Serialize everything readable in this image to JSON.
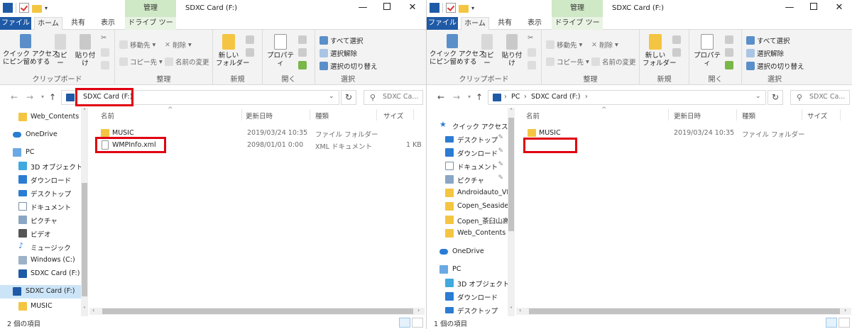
{
  "left": {
    "title": "SDXC Card (F:)",
    "manage_tab": "管理",
    "tabs": [
      "ファイル",
      "ホーム",
      "共有",
      "表示",
      "ドライブ ツール"
    ],
    "ribbon": {
      "pin_label": "クイック アクセス\nにピン留めする",
      "copy": "コピー",
      "paste": "貼り付け",
      "clipboard_group": "クリップボード",
      "move_to": "移動先",
      "delete": "削除",
      "copy_to": "コピー先",
      "rename": "名前の変更",
      "organize_group": "整理",
      "new_folder": "新しい\nフォルダー",
      "new_group": "新規",
      "properties": "プロパティ",
      "open_group": "開く",
      "select_all": "すべて選択",
      "select_none": "選択解除",
      "invert_selection": "選択の切り替え",
      "select_group": "選択"
    },
    "address": {
      "path": "SDXC Card (F:)",
      "search_placeholder": "SDXC Ca..."
    },
    "nav_items": [
      "Web_Contents",
      "OneDrive",
      "PC",
      "3D オブジェクト",
      "ダウンロード",
      "デスクトップ",
      "ドキュメント",
      "ピクチャ",
      "ビデオ",
      "ミュージック",
      "Windows (C:)",
      "SDXC Card (F:)",
      "SDXC Card (F:)",
      "MUSIC"
    ],
    "columns": {
      "name": "名前",
      "date": "更新日時",
      "type": "種類",
      "size": "サイズ"
    },
    "files": [
      {
        "name": "MUSIC",
        "date": "2019/03/24 10:35",
        "type": "ファイル フォルダー",
        "size": ""
      },
      {
        "name": "WMPInfo.xml",
        "date": "2098/01/01 0:00",
        "type": "XML ドキュメント",
        "size": "1 KB"
      }
    ],
    "status": "2 個の項目"
  },
  "right": {
    "title": "SDXC Card (F:)",
    "manage_tab": "管理",
    "tabs": [
      "ファイル",
      "ホーム",
      "共有",
      "表示",
      "ドライブ ツール"
    ],
    "ribbon": {
      "pin_label": "クイック アクセス\nにピン留めする",
      "copy": "コピー",
      "paste": "貼り付け",
      "clipboard_group": "クリップボード",
      "move_to": "移動先",
      "delete": "削除",
      "copy_to": "コピー先",
      "rename": "名前の変更",
      "organize_group": "整理",
      "new_folder": "新しい\nフォルダー",
      "new_group": "新規",
      "properties": "プロパティ",
      "open_group": "開く",
      "select_all": "すべて選択",
      "select_none": "選択解除",
      "invert_selection": "選択の切り替え",
      "select_group": "選択"
    },
    "address": {
      "crumbs": [
        "PC",
        "SDXC Card (F:)"
      ],
      "search_placeholder": "SDXC Ca..."
    },
    "nav_items": [
      "クイック アクセス",
      "デスクトップ",
      "ダウンロード",
      "ドキュメント",
      "ピクチャ",
      "Androidauto_VR",
      "Copen_Seaside",
      "Copen_茶臼山高",
      "Web_Contents",
      "OneDrive",
      "PC",
      "3D オブジェクト",
      "ダウンロード",
      "デスクトップ"
    ],
    "columns": {
      "name": "名前",
      "date": "更新日時",
      "type": "種類",
      "size": "サイズ"
    },
    "files": [
      {
        "name": "MUSIC",
        "date": "2019/03/24 10:35",
        "type": "ファイル フォルダー",
        "size": ""
      }
    ],
    "status": "1 個の項目"
  },
  "colors": {
    "accent": "#1f5aa6",
    "highlight_box": "#e00012",
    "manage_tab": "#cfe8c6",
    "selection": "#cce4f7"
  }
}
